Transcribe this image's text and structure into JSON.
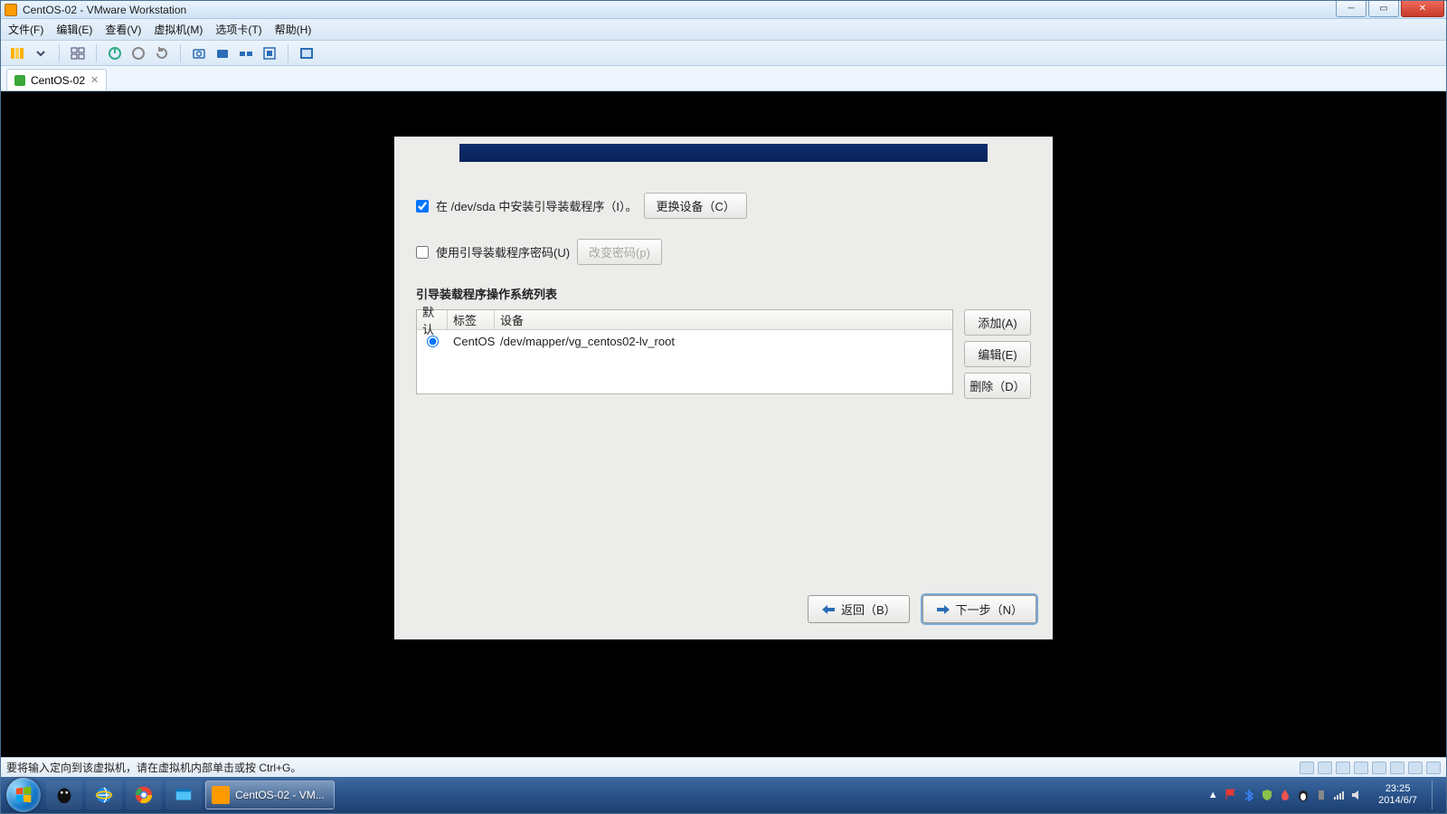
{
  "window": {
    "title": "CentOS-02 - VMware Workstation"
  },
  "menu": {
    "file": "文件(F)",
    "edit": "编辑(E)",
    "view": "查看(V)",
    "vm": "虚拟机(M)",
    "tabs": "选项卡(T)",
    "help": "帮助(H)"
  },
  "tab": {
    "label": "CentOS-02"
  },
  "installer": {
    "install_bootloader_label": "在 /dev/sda 中安装引导装载程序（I）。",
    "install_bootloader_checked": true,
    "change_device_btn": "更换设备（C）",
    "use_password_label": "使用引导装载程序密码(U)",
    "use_password_checked": false,
    "change_password_btn": "改变密码(p)",
    "os_list_title": "引导装载程序操作系统列表",
    "columns": {
      "default": "默认",
      "label": "标签",
      "device": "设备"
    },
    "rows": [
      {
        "default": true,
        "label": "CentOS",
        "device": "/dev/mapper/vg_centos02-lv_root"
      }
    ],
    "side_buttons": {
      "add": "添加(A)",
      "edit": "编辑(E)",
      "delete": "删除（D）"
    },
    "nav": {
      "back": "返回（B）",
      "next": "下一步（N）"
    }
  },
  "vmw_status": {
    "hint": "要将输入定向到该虚拟机，请在虚拟机内部单击或按 Ctrl+G。"
  },
  "taskbar": {
    "active_app": "CentOS-02 - VM...",
    "time": "23:25",
    "date": "2014/6/7"
  }
}
